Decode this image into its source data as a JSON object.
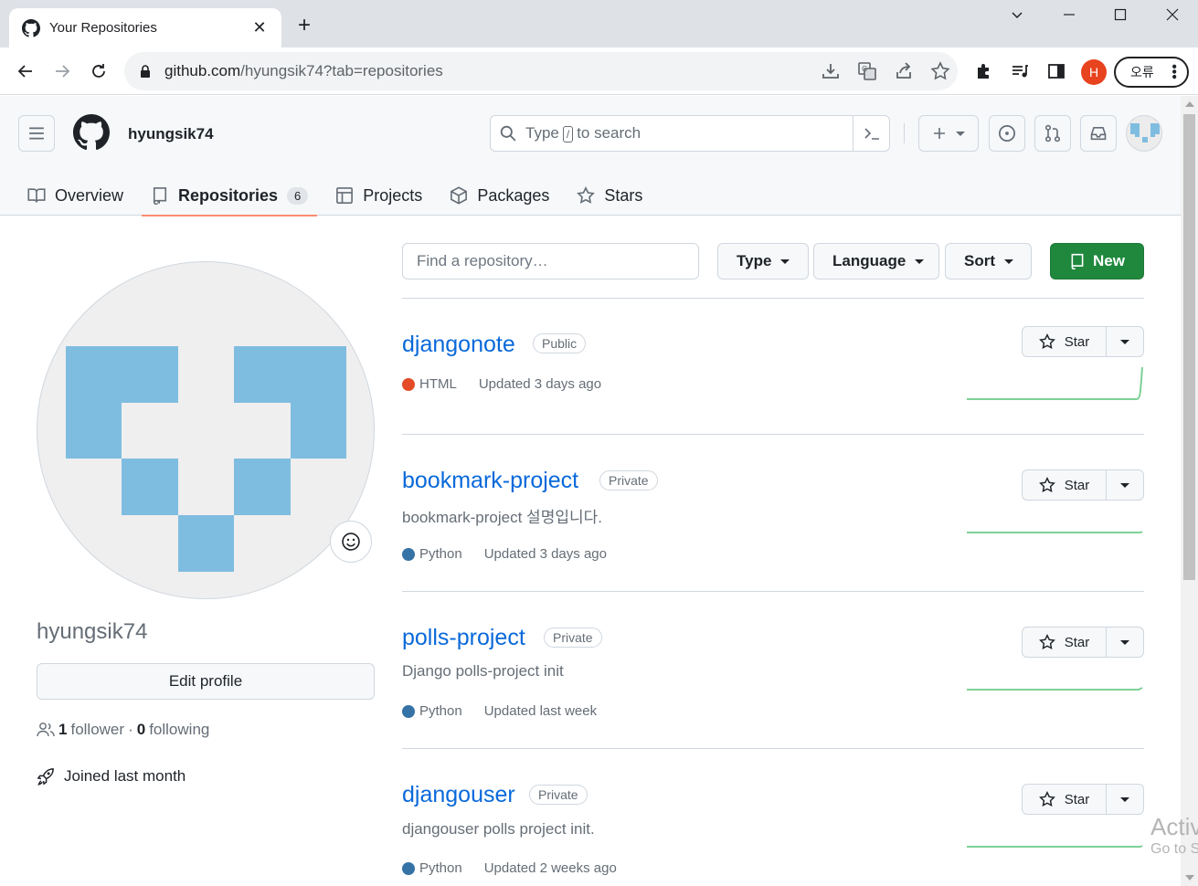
{
  "browser": {
    "tab_title": "Your Repositories",
    "url_main": "github.com",
    "url_rest": "/hyungsik74?tab=repositories",
    "profile_initial": "H",
    "error_label": "오류"
  },
  "header": {
    "username": "hyungsik74",
    "search_prefix": "Type",
    "search_key": "/",
    "search_suffix": "to search"
  },
  "nav_tabs": [
    {
      "label": "Overview",
      "icon": "book-icon"
    },
    {
      "label": "Repositories",
      "icon": "repo-icon",
      "count": "6"
    },
    {
      "label": "Projects",
      "icon": "table-icon"
    },
    {
      "label": "Packages",
      "icon": "package-icon"
    },
    {
      "label": "Stars",
      "icon": "star-icon"
    }
  ],
  "profile": {
    "name": "hyungsik74",
    "edit_label": "Edit profile",
    "followers_count": "1",
    "followers_label": "follower",
    "separator": "·",
    "following_count": "0",
    "following_label": "following",
    "joined": "Joined last month"
  },
  "filters": {
    "find_placeholder": "Find a repository…",
    "type_label": "Type",
    "language_label": "Language",
    "sort_label": "Sort",
    "new_label": "New"
  },
  "repos": [
    {
      "name": "djangonote",
      "visibility": "Public",
      "description": "",
      "language": "HTML",
      "lang_color": "#e34c26",
      "updated": "Updated 3 days ago",
      "star_label": "Star"
    },
    {
      "name": "bookmark-project",
      "visibility": "Private",
      "description": "bookmark-project 설명입니다.",
      "language": "Python",
      "lang_color": "#3572A5",
      "updated": "Updated 3 days ago",
      "star_label": "Star"
    },
    {
      "name": "polls-project",
      "visibility": "Private",
      "description": "Django polls-project init",
      "language": "Python",
      "lang_color": "#3572A5",
      "updated": "Updated last week",
      "star_label": "Star"
    },
    {
      "name": "djangouser",
      "visibility": "Private",
      "description": "djangouser polls project init.",
      "language": "Python",
      "lang_color": "#3572A5",
      "updated": "Updated 2 weeks ago",
      "star_label": "Star"
    }
  ],
  "watermark": {
    "line1": "Activ",
    "line2": "Go to S"
  },
  "colors": {
    "accent_blue": "#0969da",
    "new_green": "#1f883d",
    "tab_underline": "#fd8c73",
    "avatar_blue": "#7fbde0"
  }
}
